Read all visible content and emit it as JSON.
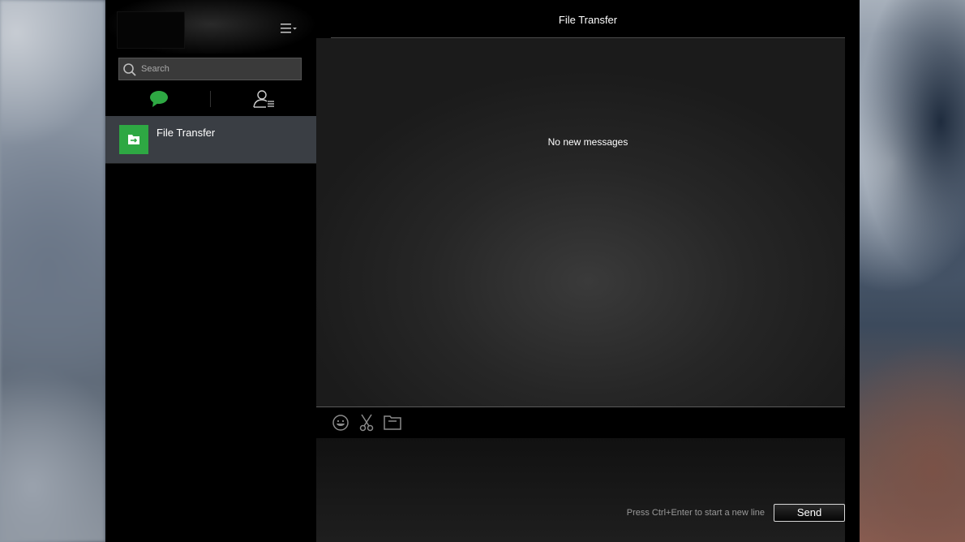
{
  "app": {
    "conversation_title": "File Transfer"
  },
  "sidebar": {
    "menu_icon": "hamburger-menu-icon",
    "search": {
      "placeholder": "Search",
      "value": ""
    },
    "tabs": [
      {
        "name": "chats",
        "icon": "chat-bubble-icon",
        "active": true,
        "color": "#2ea843"
      },
      {
        "name": "contacts",
        "icon": "contacts-icon",
        "active": false
      }
    ],
    "chats": [
      {
        "name": "File Transfer",
        "icon": "file-transfer-folder-icon",
        "icon_color": "#2ea843",
        "selected": true
      }
    ]
  },
  "main": {
    "empty_state": "No new messages",
    "toolbar": [
      {
        "name": "emoji",
        "icon": "emoji-icon"
      },
      {
        "name": "screenshot",
        "icon": "scissors-icon"
      },
      {
        "name": "send-file",
        "icon": "folder-icon"
      }
    ],
    "compose": {
      "value": "",
      "hint": "Press Ctrl+Enter to start a new line",
      "send_label": "Send"
    }
  },
  "colors": {
    "accent": "#2ea843",
    "selected_item_bg": "#3a3e44",
    "window_bg": "#000000"
  }
}
